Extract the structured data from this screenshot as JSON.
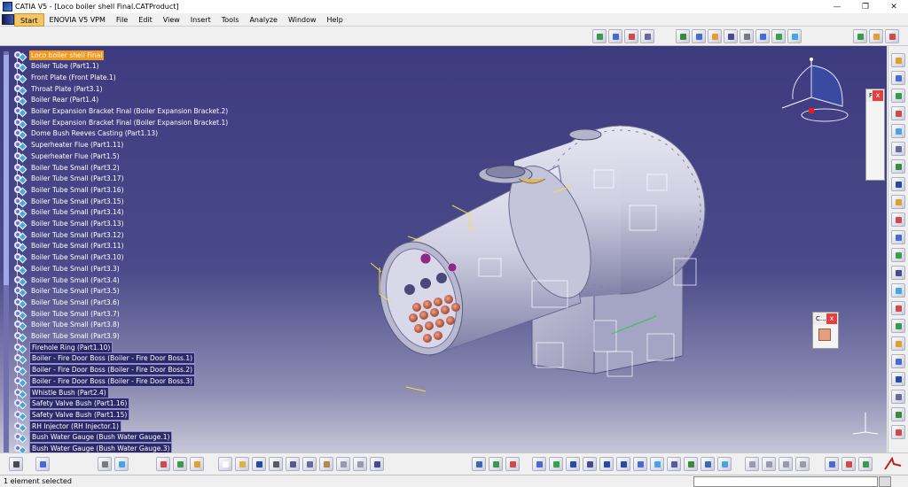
{
  "window": {
    "title": "CATIA V5 - [Loco boiler shell Final.CATProduct]",
    "minimize_glyph": "—",
    "restore_glyph": "❐",
    "close_glyph": "✕"
  },
  "menubar": {
    "items": [
      {
        "label": "Start"
      },
      {
        "label": "ENOVIA V5 VPM"
      },
      {
        "label": "File"
      },
      {
        "label": "Edit"
      },
      {
        "label": "View"
      },
      {
        "label": "Insert"
      },
      {
        "label": "Tools"
      },
      {
        "label": "Analyze"
      },
      {
        "label": "Window"
      },
      {
        "label": "Help"
      }
    ]
  },
  "tree": {
    "root": "Loco boiler shell Final",
    "items": [
      "Boiler Tube (Part1.1)",
      "Front Plate (Front Plate.1)",
      "Throat Plate (Part3.1)",
      "Boiler Rear (Part1.4)",
      "Boiler Expansion Bracket Final (Boiler Expansion Bracket.2)",
      "Boiler Expansion Bracket Final (Boiler Expansion Bracket.1)",
      "Dome Bush Reeves Casting (Part1.13)",
      "Superheater Flue (Part1.11)",
      "Superheater Flue (Part1.5)",
      "Boiler Tube Small (Part3.2)",
      "Boiler Tube Small (Part3.17)",
      "Boiler Tube Small (Part3.16)",
      "Boiler Tube Small (Part3.15)",
      "Boiler Tube Small (Part3.14)",
      "Boiler Tube Small (Part3.13)",
      "Boiler Tube Small (Part3.12)",
      "Boiler Tube Small (Part3.11)",
      "Boiler Tube Small (Part3.10)",
      "Boiler Tube Small (Part3.3)",
      "Boiler Tube Small (Part3.4)",
      "Boiler Tube Small (Part3.5)",
      "Boiler Tube Small (Part3.6)",
      "Boiler Tube Small (Part3.7)",
      "Boiler Tube Small (Part3.8)",
      "Boiler Tube Small (Part3.9)",
      "Firehole Ring (Part1.10)",
      "Boiler - Fire Door Boss (Boiler - Fire Door Boss.1)",
      "Boiler - Fire Door Boss (Boiler - Fire Door Boss.2)",
      "Boiler - Fire Door Boss (Boiler - Fire Door Boss.3)",
      "Whistle Bush (Part2.4)",
      "Safety Valve Bush (Part1.16)",
      "Safety Valve Bush (Part1.15)",
      "RH Injector (RH Injector.1)",
      "Bush Water Gauge (Bush Water Gauge.1)",
      "Bush Water Gauge (Bush Water Gauge.3)"
    ]
  },
  "panels": {
    "small_panel_title": "C...",
    "close_glyph": "x",
    "side_panel_title": "F"
  },
  "status": {
    "message": "1 element selected",
    "command_input": ""
  },
  "colors": {
    "viewport_top": "#3d3b7e",
    "viewport_bottom": "#c7c7d8",
    "selection": "#f29a1e",
    "model_body": "#d4d4e6"
  }
}
